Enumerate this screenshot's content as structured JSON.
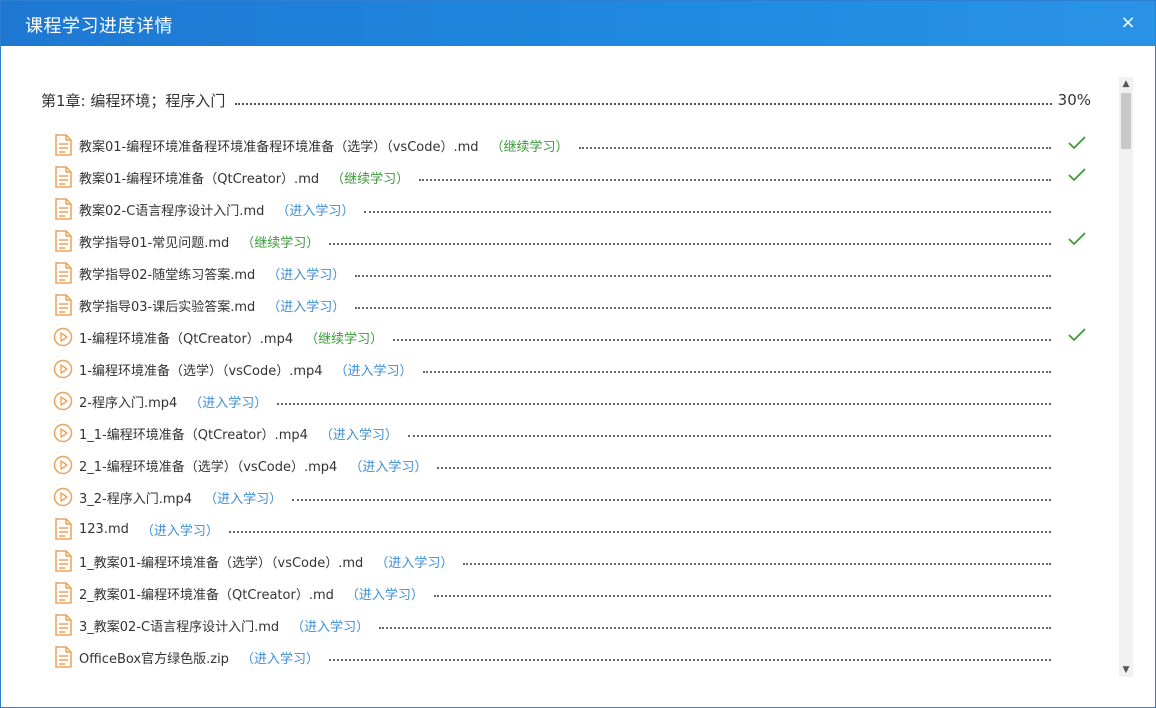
{
  "dialog": {
    "title": "课程学习进度详情",
    "close_label": "×"
  },
  "chapter": {
    "title": "第1章: 编程环境；程序入门",
    "progress": "30%"
  },
  "items": [
    {
      "name": "教案01-编程环境准备程环境准备程环境准备（选学）（vsCode）.md",
      "action": "（继续学习）",
      "status": "continue",
      "type": "doc",
      "done": true
    },
    {
      "name": "教案01-编程环境准备（QtCreator）.md",
      "action": "（继续学习）",
      "status": "continue",
      "type": "doc",
      "done": true
    },
    {
      "name": "教案02-C语言程序设计入门.md",
      "action": "（进入学习）",
      "status": "enter",
      "type": "doc",
      "done": false
    },
    {
      "name": "教学指导01-常见问题.md",
      "action": "（继续学习）",
      "status": "continue",
      "type": "doc",
      "done": true
    },
    {
      "name": "教学指导02-随堂练习答案.md",
      "action": "（进入学习）",
      "status": "enter",
      "type": "doc",
      "done": false
    },
    {
      "name": "教学指导03-课后实验答案.md",
      "action": "（进入学习）",
      "status": "enter",
      "type": "doc",
      "done": false
    },
    {
      "name": "1-编程环境准备（QtCreator）.mp4",
      "action": "（继续学习）",
      "status": "continue",
      "type": "video",
      "done": true
    },
    {
      "name": "1-编程环境准备（选学）（vsCode）.mp4",
      "action": "（进入学习）",
      "status": "enter",
      "type": "video",
      "done": false
    },
    {
      "name": "2-程序入门.mp4",
      "action": "（进入学习）",
      "status": "enter",
      "type": "video",
      "done": false
    },
    {
      "name": "1_1-编程环境准备（QtCreator）.mp4",
      "action": "（进入学习）",
      "status": "enter",
      "type": "video",
      "done": false
    },
    {
      "name": "2_1-编程环境准备（选学）（vsCode）.mp4",
      "action": "（进入学习）",
      "status": "enter",
      "type": "video",
      "done": false
    },
    {
      "name": "3_2-程序入门.mp4",
      "action": "（进入学习）",
      "status": "enter",
      "type": "video",
      "done": false
    },
    {
      "name": "123.md",
      "action": "（进入学习）",
      "status": "enter",
      "type": "doc",
      "done": false
    },
    {
      "name": "1_教案01-编程环境准备（选学）（vsCode）.md",
      "action": "（进入学习）",
      "status": "enter",
      "type": "doc",
      "done": false
    },
    {
      "name": "2_教案01-编程环境准备（QtCreator）.md",
      "action": "（进入学习）",
      "status": "enter",
      "type": "doc",
      "done": false
    },
    {
      "name": "3_教案02-C语言程序设计入门.md",
      "action": "（进入学习）",
      "status": "enter",
      "type": "doc",
      "done": false
    },
    {
      "name": "OfficeBox官方绿色版.zip",
      "action": "（进入学习）",
      "status": "enter",
      "type": "doc",
      "done": false
    }
  ],
  "colors": {
    "titlebar": "#1f82db",
    "continue": "#3a9b3a",
    "enter": "#3c8fd8",
    "icon": "#f0a058",
    "check": "#3a9b3a"
  },
  "icons": {
    "doc": "document-icon",
    "video": "play-circle-icon",
    "done": "checkmark-icon"
  }
}
